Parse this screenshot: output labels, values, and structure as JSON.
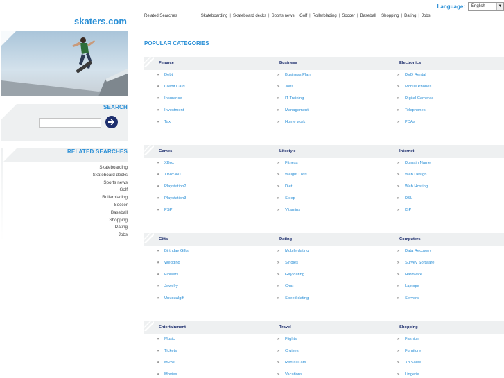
{
  "site": {
    "logo": "skaters.com"
  },
  "language": {
    "label": "Language:",
    "selected": "English"
  },
  "top_related": {
    "label": "Related Searches",
    "items": [
      "Skateboarding",
      "Skateboard decks",
      "Sports news",
      "Golf",
      "Rollerblading",
      "Soccer",
      "Baseball",
      "Shopping",
      "Dating",
      "Jobs"
    ]
  },
  "search": {
    "title": "SEARCH",
    "placeholder": ""
  },
  "sidebar_related": {
    "title": "RELATED SEARCHES",
    "items": [
      "Skateboarding",
      "Skateboard decks",
      "Sports news",
      "Golf",
      "Rollerblading",
      "Soccer",
      "Baseball",
      "Shopping",
      "Dating",
      "Jobs"
    ]
  },
  "popular": {
    "title": "POPULAR CATEGORIES",
    "rows": [
      [
        {
          "name": "Finance",
          "items": [
            "Debt",
            "Credit Card",
            "Insurance",
            "Investment",
            "Tax"
          ]
        },
        {
          "name": "Business",
          "items": [
            "Business Plan",
            "Jobs",
            "IT Training",
            "Management",
            "Home work"
          ]
        },
        {
          "name": "Electronics",
          "items": [
            "DVD Rental",
            "Mobile Phones",
            "Digital Cameras",
            "Telephones",
            "PDAs"
          ]
        }
      ],
      [
        {
          "name": "Games",
          "items": [
            "XBox",
            "XBox360",
            "Playstation2",
            "Playstation3",
            "PSP"
          ]
        },
        {
          "name": "Lifestyle",
          "items": [
            "Fitness",
            "Weight Loss",
            "Diet",
            "Sleep",
            "Vitamins"
          ]
        },
        {
          "name": "Internet",
          "items": [
            "Domain Name",
            "Web Design",
            "Web Hosting",
            "DSL",
            "ISP"
          ]
        }
      ],
      [
        {
          "name": "Gifts",
          "items": [
            "Birthday Gifts",
            "Wedding",
            "Flowers",
            "Jewelry",
            "Unusualgift"
          ]
        },
        {
          "name": "Dating",
          "items": [
            "Mobile dating",
            "Singles",
            "Gay dating",
            "Chat",
            "Speed dating"
          ]
        },
        {
          "name": "Computers",
          "items": [
            "Data Recovery",
            "Survey Software",
            "Hardware",
            "Laptops",
            "Servers"
          ]
        }
      ],
      [
        {
          "name": "Entertainment",
          "items": [
            "Music",
            "Tickets",
            "MP3s",
            "Movies"
          ]
        },
        {
          "name": "Travel",
          "items": [
            "Flights",
            "Cruises",
            "Rental Cars",
            "Vacations"
          ]
        },
        {
          "name": "Shopping",
          "items": [
            "Fashion",
            "Furniture",
            "Xp Sales",
            "Lingerie"
          ]
        }
      ]
    ]
  },
  "colors": {
    "accent": "#2a8fd6",
    "heading": "#1a2b6b",
    "panel": "#eef0f1"
  },
  "icons": {
    "bullet": "»",
    "dropdown": "▼",
    "go": "arrow-right-circle-icon"
  }
}
